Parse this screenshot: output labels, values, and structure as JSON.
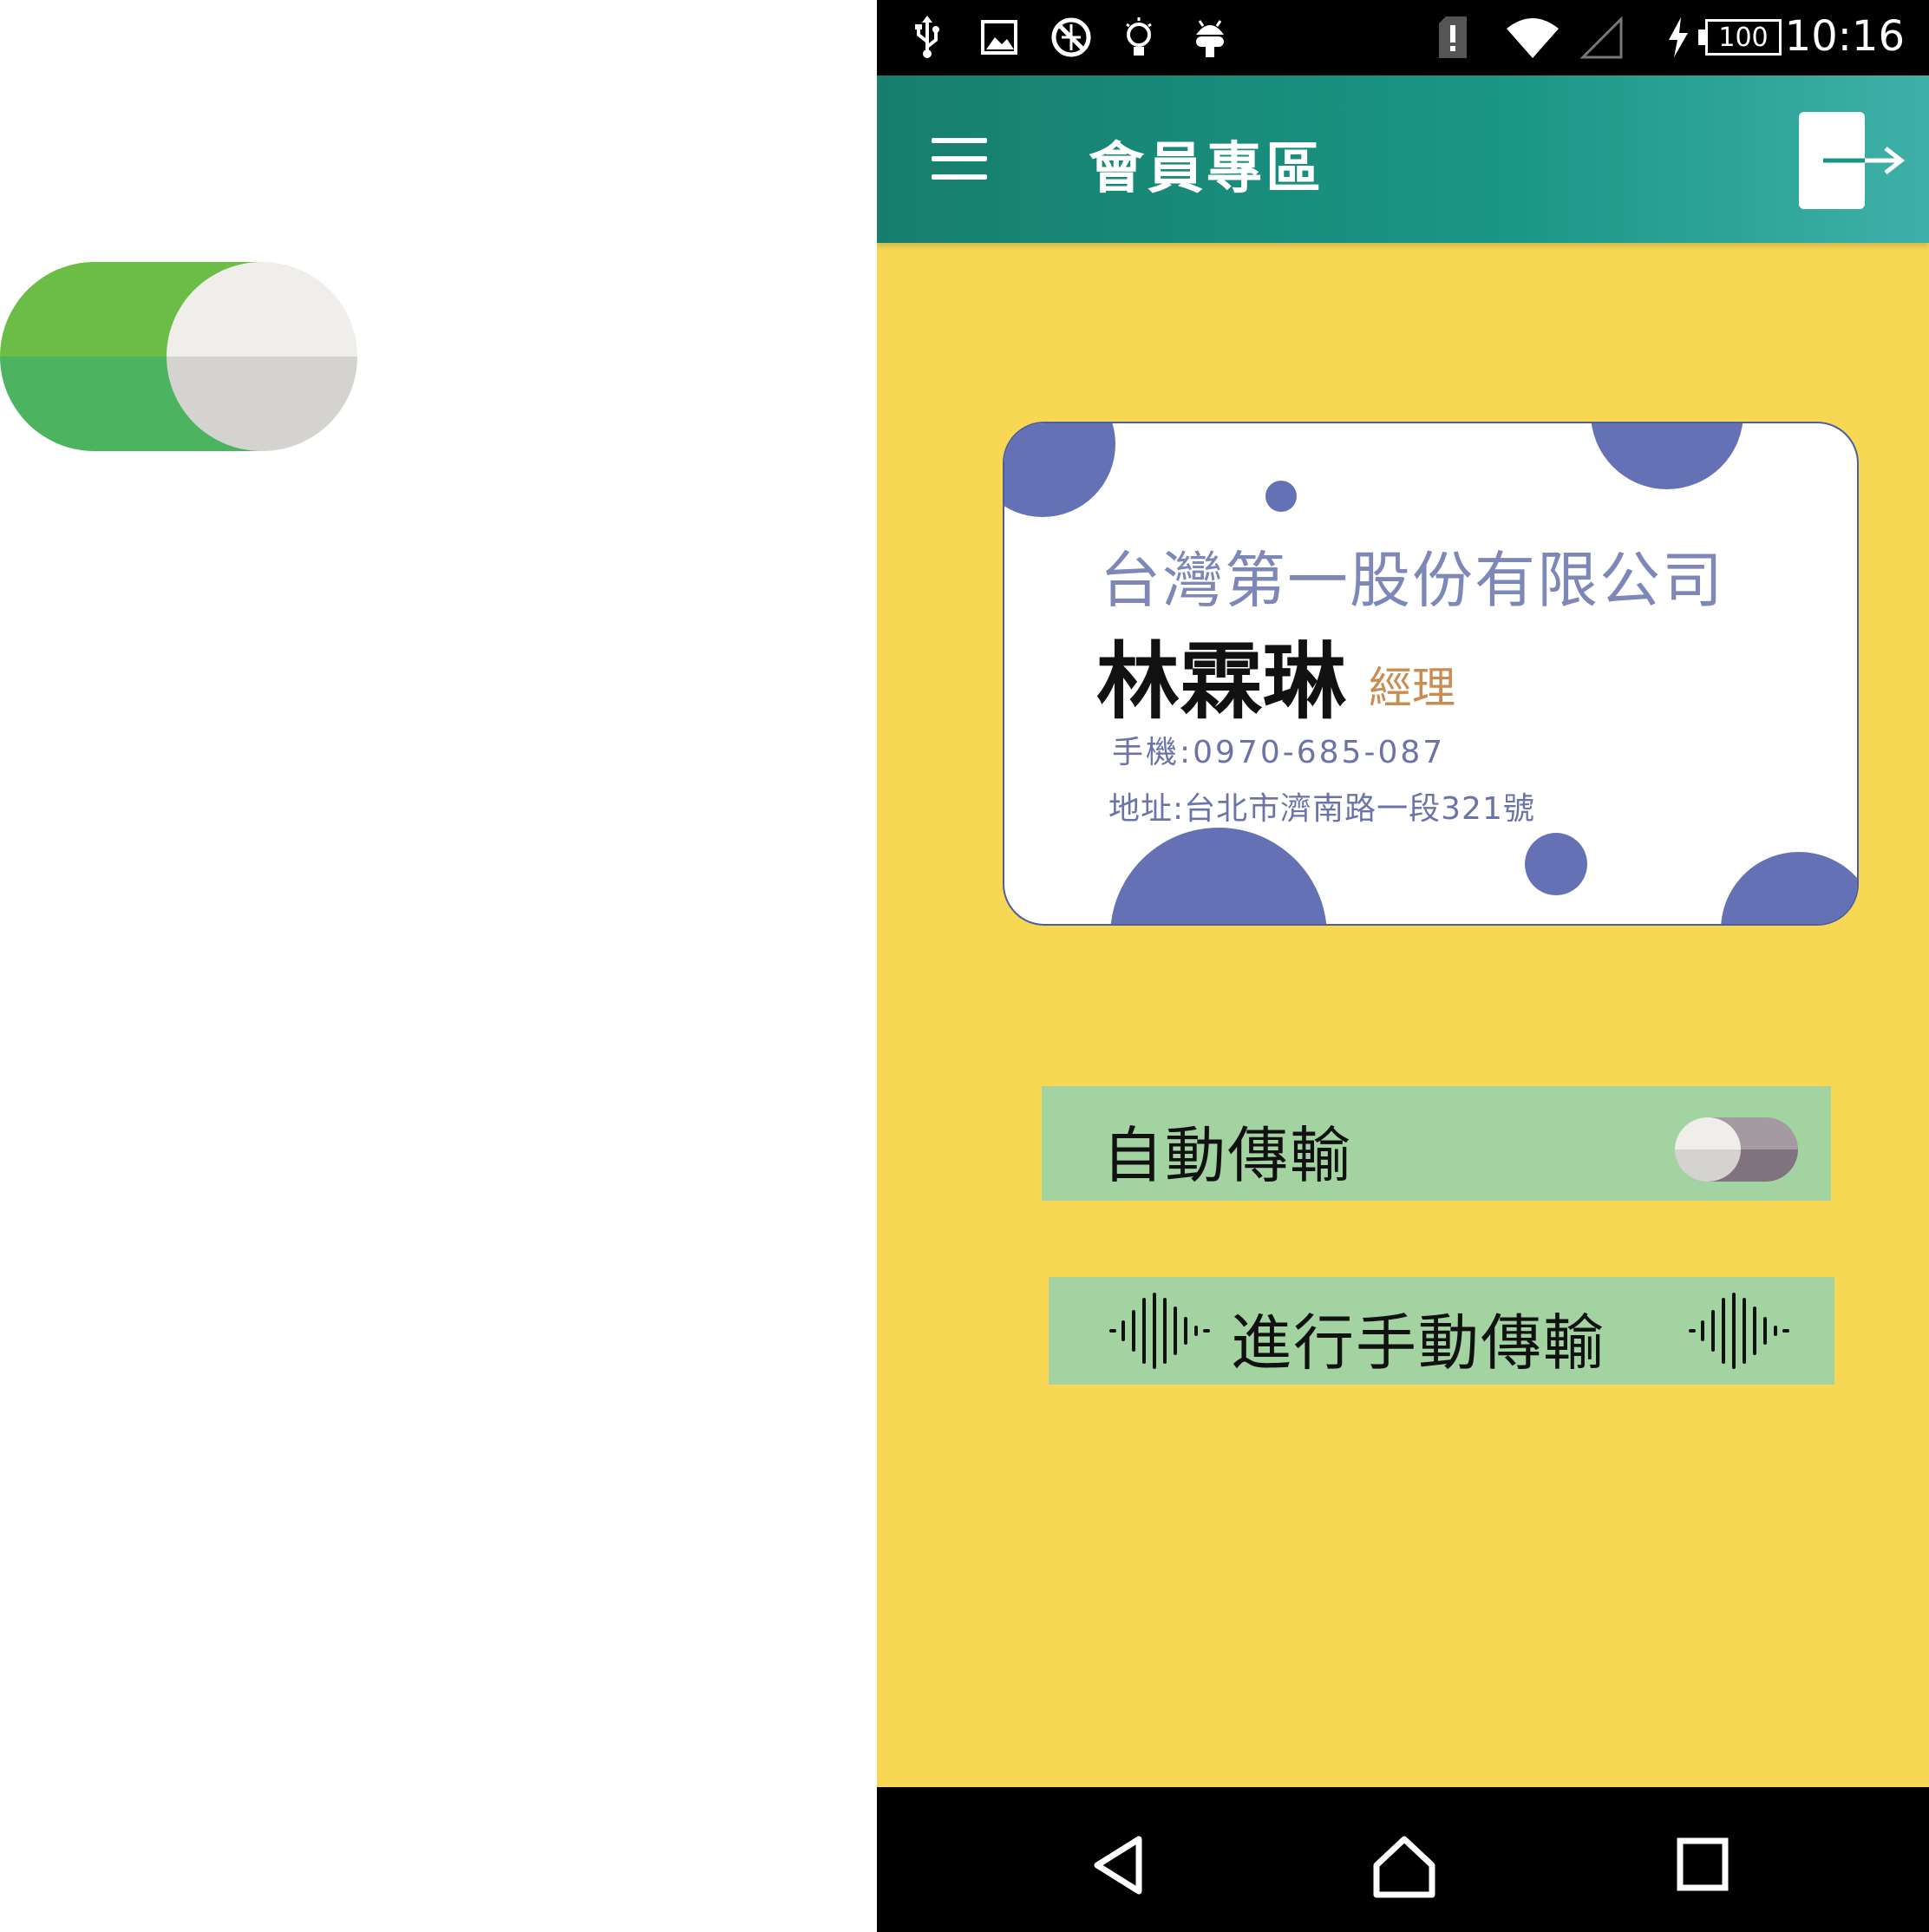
{
  "status_bar": {
    "icons": [
      "usb-icon",
      "image-icon",
      "no-sync-icon",
      "bulb-icon",
      "android-icon",
      "sim-alert-icon",
      "wifi-icon",
      "signal-icon",
      "charging-icon"
    ],
    "battery": "100",
    "time": "10:16"
  },
  "app_bar": {
    "title": "會員專區",
    "menu_icon": "hamburger-menu-icon",
    "logout_icon": "logout-icon"
  },
  "card": {
    "company": "台灣第一股份有限公司",
    "name": "林霖琳",
    "title": "經理",
    "mobile": "手機:0970-685-087",
    "address": "地址:台北市濟南路一段321號",
    "accent_color": "#6471b5"
  },
  "auto_transfer": {
    "label": "自動傳輸",
    "toggle_on": false
  },
  "manual_transfer": {
    "label": "進行手動傳輸",
    "icon": "sound-wave-icon"
  },
  "big_toggle": {
    "on": true,
    "track_color": "#6cbd45"
  },
  "colors": {
    "background": "#f8d755",
    "app_bar": "#1a9686",
    "button_bg": "#a2d3a1"
  },
  "nav_bar": {
    "icons": [
      "back-icon",
      "home-icon",
      "recents-icon"
    ]
  }
}
